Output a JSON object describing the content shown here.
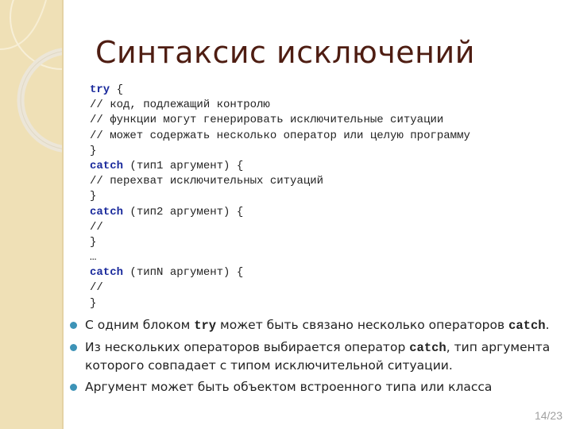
{
  "slide": {
    "title": "Синтаксис исключений",
    "code_lines": [
      {
        "kw": "try",
        "rest": " {"
      },
      {
        "kw": "",
        "rest": "// код, подлежащий контролю"
      },
      {
        "kw": "",
        "rest": "// функции могут генерировать исключительные ситуации"
      },
      {
        "kw": "",
        "rest": "// может содержать несколько оператор или целую программу"
      },
      {
        "kw": "",
        "rest": "}"
      },
      {
        "kw": "catch",
        "rest": " (тип1 аргумент) {"
      },
      {
        "kw": "",
        "rest": "// перехват исключительных ситуаций"
      },
      {
        "kw": "",
        "rest": "}"
      },
      {
        "kw": "catch",
        "rest": " (тип2 аргумент) {"
      },
      {
        "kw": "",
        "rest": "//"
      },
      {
        "kw": "",
        "rest": "}"
      },
      {
        "kw": "",
        "rest": "…"
      },
      {
        "kw": "catch",
        "rest": " (типN аргумент) {"
      },
      {
        "kw": "",
        "rest": "//"
      },
      {
        "kw": "",
        "rest": "}"
      }
    ],
    "bullets": [
      {
        "a": "С одним блоком ",
        "code1": "try",
        "b": " может быть связано несколько операторов ",
        "code2": "catch",
        "c": "."
      },
      {
        "a": "Из нескольких операторов выбирается оператор ",
        "code1": "catch",
        "b": ", тип аргумента которого совпадает с типом исключительной ситуации.",
        "code2": "",
        "c": ""
      },
      {
        "a": "Аргумент может быть объектом встроенного типа или класса",
        "code1": "",
        "b": "",
        "code2": "",
        "c": ""
      }
    ],
    "page_number": "14/23",
    "colors": {
      "title": "#4e1d12",
      "keyword": "#1a2a9c",
      "bullet": "#3d93b7",
      "sidebar": "#efe0b6"
    }
  }
}
